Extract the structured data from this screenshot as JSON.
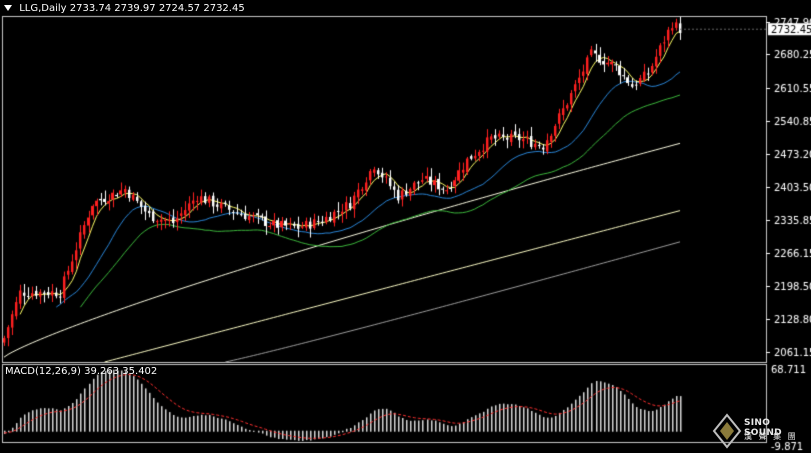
{
  "header": {
    "symbol_label": "LLG,Daily",
    "ohlc": "2733.74 2739.97 2724.57 2732.45"
  },
  "price_axis": {
    "labels": [
      "2747.90",
      "2680.25",
      "2610.55",
      "2540.85",
      "2473.20",
      "2403.50",
      "2335.85",
      "2266.15",
      "2198.50",
      "2128.80",
      "2061.15"
    ],
    "last_price": "2732.45"
  },
  "macd": {
    "label": "MACD(12,26,9) 39.263 35.402",
    "axis_top": "68.711",
    "axis_bottom": "-9.871"
  },
  "watermark": {
    "brand": "SINO SOUND",
    "sub": "漢 聲 集 團"
  },
  "colors": {
    "background": "#000000",
    "frame": "#c8c8c8",
    "bull_candle": "#ff2020",
    "bear_candle": "#ffffff",
    "ma_yellow": "#ffff66",
    "ma_blue": "#2a86d8",
    "ma_green": "#3cb83c",
    "ma_white": "#ffffe6",
    "ma_cream": "#ffffc8",
    "ma_gray": "#a0a0a0",
    "macd_hist": "#d8d8d8",
    "macd_signal": "#ff3030"
  },
  "chart_data": {
    "type": "candlestick",
    "title": "LLG,Daily",
    "ylim": [
      2040,
      2760
    ],
    "key_levels": [
      {
        "bar": 0,
        "close": 2090
      },
      {
        "bar": 4,
        "close": 2185
      },
      {
        "bar": 14,
        "close": 2185
      },
      {
        "bar": 22,
        "close": 2370
      },
      {
        "bar": 30,
        "close": 2400
      },
      {
        "bar": 36,
        "close": 2345
      },
      {
        "bar": 42,
        "close": 2330
      },
      {
        "bar": 48,
        "close": 2385
      },
      {
        "bar": 55,
        "close": 2360
      },
      {
        "bar": 62,
        "close": 2340
      },
      {
        "bar": 67,
        "close": 2325
      },
      {
        "bar": 73,
        "close": 2320
      },
      {
        "bar": 79,
        "close": 2335
      },
      {
        "bar": 86,
        "close": 2370
      },
      {
        "bar": 92,
        "close": 2450
      },
      {
        "bar": 98,
        "close": 2385
      },
      {
        "bar": 104,
        "close": 2420
      },
      {
        "bar": 110,
        "close": 2400
      },
      {
        "bar": 115,
        "close": 2460
      },
      {
        "bar": 121,
        "close": 2505
      },
      {
        "bar": 128,
        "close": 2505
      },
      {
        "bar": 134,
        "close": 2490
      },
      {
        "bar": 140,
        "close": 2580
      },
      {
        "bar": 146,
        "close": 2680
      },
      {
        "bar": 152,
        "close": 2655
      },
      {
        "bar": 156,
        "close": 2615
      },
      {
        "bar": 160,
        "close": 2640
      },
      {
        "bar": 166,
        "close": 2745
      },
      {
        "bar": 168,
        "close": 2732.45
      }
    ],
    "macd_range": [
      -9.871,
      68.711
    ],
    "macd_current": {
      "macd": 39.263,
      "signal": 35.402
    }
  }
}
